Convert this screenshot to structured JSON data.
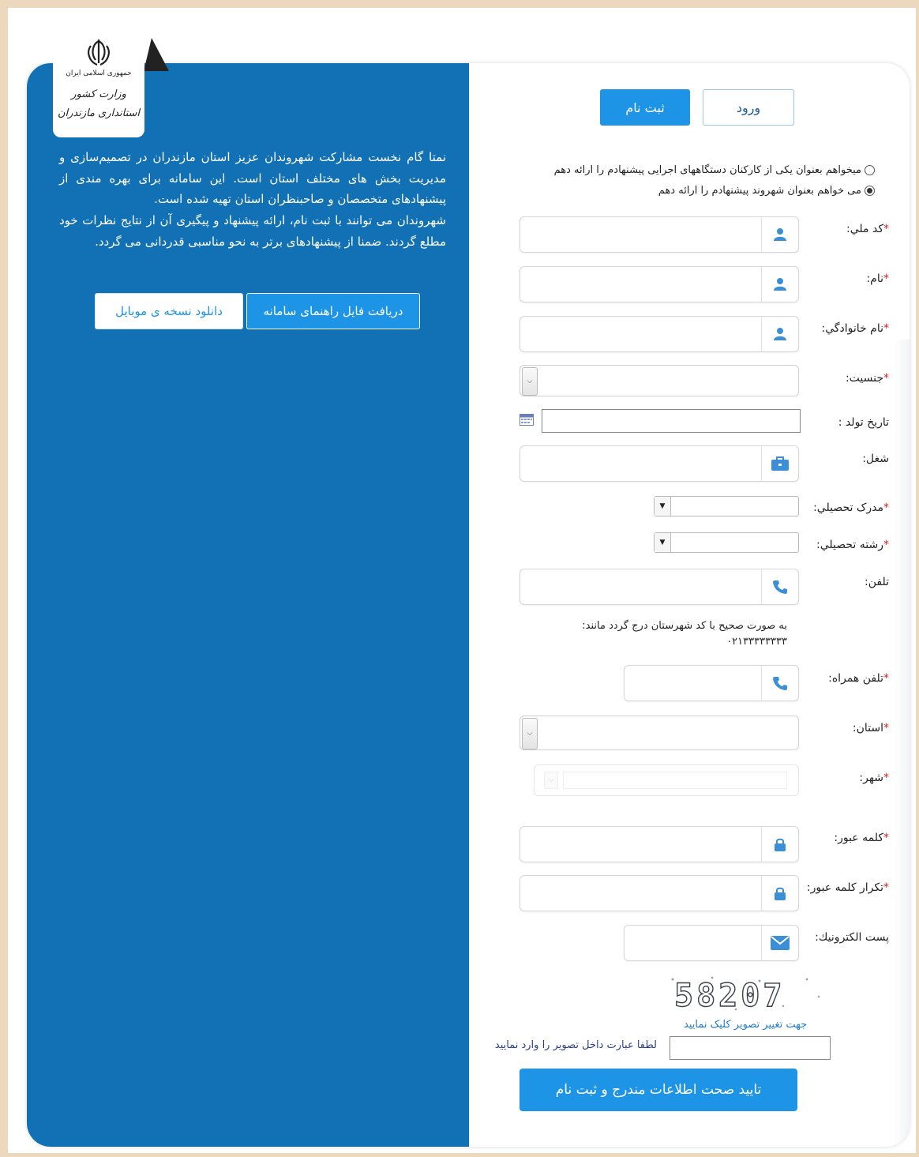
{
  "logo": {
    "line1": "جمهوری اسلامی ایران",
    "line2": "وزارت کشور",
    "line3": "استانداری مازندران"
  },
  "intro": {
    "paragraph1": "نمتا گام نخست مشارکت شهروندان عزیز استان مازندران در تصمیم‌سازی و مدیریت بخش های مختلف استان است. این سامانه برای بهره مندی از پیشنهادهای متخصصان و صاحبنظران استان تهیه شده است.",
    "paragraph2": "شهروندان می توانند با ثبت نام، ارائه پیشنهاد و پیگیری آن از نتایج نظرات خود مطلع گردند. ضمنا از پیشنهادهای برتر به نحو مناسبی قدردانی می گردد."
  },
  "buttons": {
    "guide": "دریافت فایل راهنمای سامانه",
    "mobile": "دانلود نسخه ی موبایل",
    "register_tab": "ثبت نام",
    "login_tab": "ورود",
    "submit": "تایید صحت اطلاعات مندرج و ثبت نام"
  },
  "radios": {
    "option1": "میخواهم بعنوان یکی از کارکنان دستگاههای اجرایی پیشنهادم را ارائه دهم",
    "option2": "می خواهم بعنوان شهروند پیشنهادم را ارائه دهم",
    "selected": "option2"
  },
  "form": {
    "national_code": "کد ملي:",
    "first_name": "نام:",
    "last_name": "نام خانوادگي:",
    "gender": "جنسيت:",
    "birth_date": "تاريخ تولد :",
    "job": "شغل:",
    "degree": "مدرک تحصيلي:",
    "field": "رشته تحصيلي:",
    "phone": "تلفن:",
    "phone_hint": "به صورت صحيح با کد شهرستان درج گردد مانند: ۰۲۱۳۳۳۳۳۳۳۳",
    "mobile": "تلفن همراه:",
    "province": "استان:",
    "city": "شهر:",
    "password": "کلمه عبور:",
    "password_repeat": "تکرار کلمه عبور:",
    "email": "پست الکترونيك:",
    "required_mark": "*"
  },
  "captcha": {
    "code": "58207",
    "refresh_link": "جهت تغيير تصوير کليک نماييد",
    "input_label": "لطفا عبارت داخل تصویر را وارد نمایید"
  },
  "colors": {
    "panel": "#1270b4",
    "accent": "#1e94e6",
    "background": "#ecd9bd",
    "required": "#e02020"
  }
}
